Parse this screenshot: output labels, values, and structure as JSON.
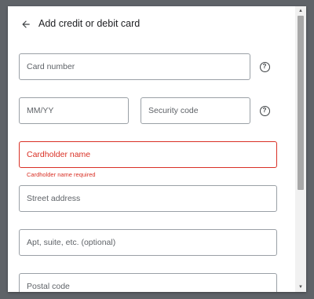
{
  "dialog": {
    "title": "Add credit or debit card",
    "back_icon": "arrow-left-icon",
    "help_icon": "question-circle-icon",
    "help_glyph": "?"
  },
  "fields": {
    "card_number": {
      "placeholder": "Card number",
      "value": ""
    },
    "expiry": {
      "placeholder": "MM/YY",
      "value": ""
    },
    "security_code": {
      "placeholder": "Security code",
      "value": ""
    },
    "cardholder_name": {
      "placeholder": "Cardholder name",
      "value": "",
      "error": "Cardholder name required"
    },
    "street_address": {
      "placeholder": "Street address",
      "value": ""
    },
    "apt_suite": {
      "placeholder": "Apt, suite, etc. (optional)",
      "value": ""
    },
    "postal_code": {
      "placeholder": "Postal code",
      "value": ""
    }
  },
  "scrollbar": {
    "up_arrow": "▲",
    "down_arrow": "▼"
  },
  "colors": {
    "error": "#d93025",
    "border": "#9aa0a6",
    "text": "#202124"
  }
}
